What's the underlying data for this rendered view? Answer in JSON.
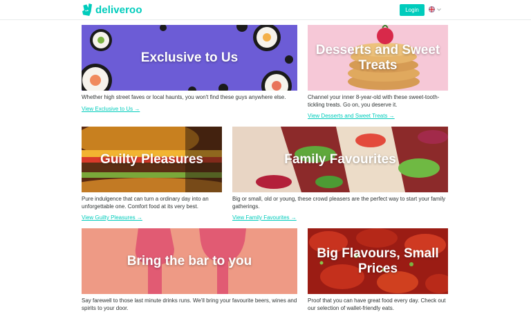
{
  "header": {
    "brand": "deliveroo",
    "login_label": "Login",
    "language_icon": "uk-flag-icon",
    "brand_color": "#00ccbc"
  },
  "cards": [
    {
      "title": "Exclusive to Us",
      "description": "Whether high street faves or local haunts, you won't find these guys anywhere else.",
      "link": "View Exclusive to Us →"
    },
    {
      "title": "Desserts and Sweet Treats",
      "description": "Channel your inner 8-year-old with these sweet-tooth-tickling treats. Go on, you deserve it.",
      "link": "View Desserts and Sweet Treats →"
    },
    {
      "title": "Guilty Pleasures",
      "description": "Pure indulgence that can turn a ordinary day into an unforgettable one. Comfort food at its very best.",
      "link": "View Guilty Pleasures →"
    },
    {
      "title": "Family Favourites",
      "description": "Big or small, old or young, these crowd pleasers are the perfect way to start your family gatherings.",
      "link": "View Family Favourites →"
    },
    {
      "title": "Bring the bar to you",
      "description": "Say farewell to those last minute drinks runs. We'll bring your favourite beers, wines and spirits to your door.",
      "link": ""
    },
    {
      "title": "Big Flavours, Small Prices",
      "description": "Proof that you can have great food every day. Check out our selection of wallet-friendly eats.",
      "link": ""
    }
  ]
}
